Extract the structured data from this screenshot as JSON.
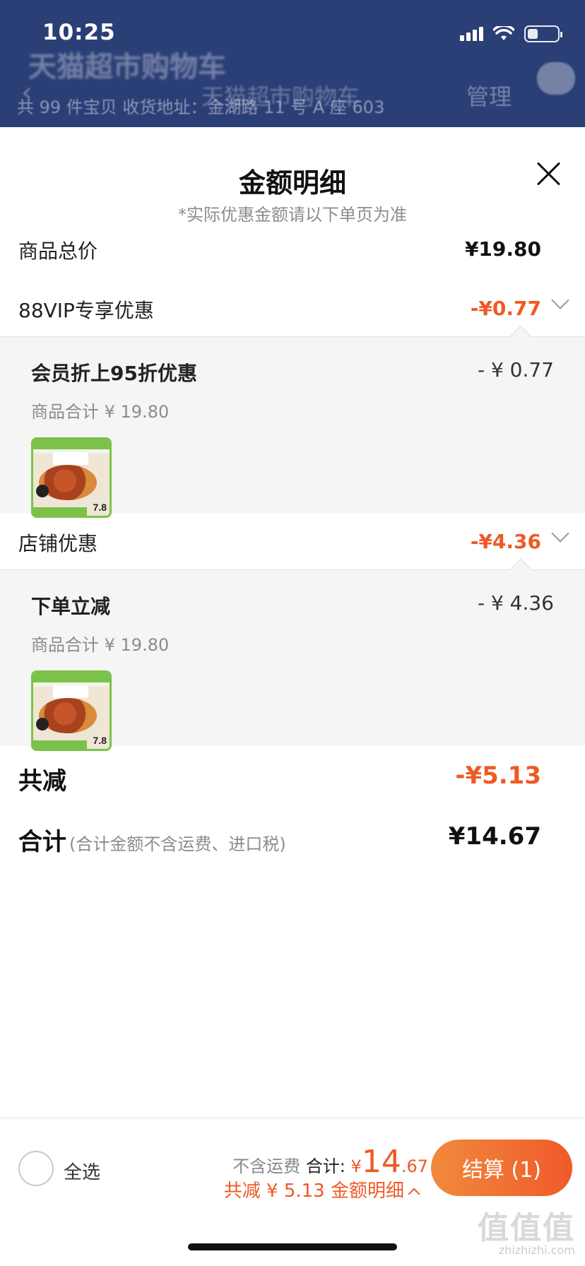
{
  "status_bar": {
    "time": "10:25"
  },
  "background_header": {
    "title_top": "天猫超市购物车",
    "back_arrow": "‹",
    "title": "天猫超市购物车",
    "manage": "管理",
    "subtitle": "共 99 件宝贝    收货地址：金湖路 11 号 A 座 603"
  },
  "sheet": {
    "title": "金额明细",
    "subtitle": "*实际优惠金额请以下单页为准",
    "subtotal": {
      "label": "商品总价",
      "amount": "¥19.80"
    },
    "vip": {
      "label": "88VIP专享优惠",
      "amount": "-¥0.77",
      "detail": {
        "title": "会员折上95折优惠",
        "amount": "- ¥ 0.77",
        "sub": "商品合计 ¥ 19.80",
        "thumb_price": "7.8"
      }
    },
    "store": {
      "label": "店铺优惠",
      "amount": "-¥4.36",
      "detail": {
        "title": "下单立减",
        "amount": "- ¥ 4.36",
        "sub": "商品合计 ¥ 19.80",
        "thumb_price": "7.8"
      }
    },
    "total_discount": {
      "label": "共减",
      "amount": "-¥5.13"
    },
    "grand_total": {
      "label": "合计",
      "note": "(合计金额不含运费、进口税)",
      "amount": "¥14.67"
    }
  },
  "bottom_bar": {
    "select_all": "全选",
    "shipping_note": "不含运费",
    "total_label": "合计:",
    "total_currency": "¥",
    "total_int": "14",
    "total_dec": ".67",
    "discount_line": "共减 ¥ 5.13  金额明细",
    "checkout": "结算 (1)"
  },
  "watermark": {
    "main": "值值值",
    "sub": "zhizhizhi.com"
  },
  "colors": {
    "accent": "#ee5a24",
    "header_bg": "#2b3f77",
    "panel_bg": "#f5f5f5"
  }
}
